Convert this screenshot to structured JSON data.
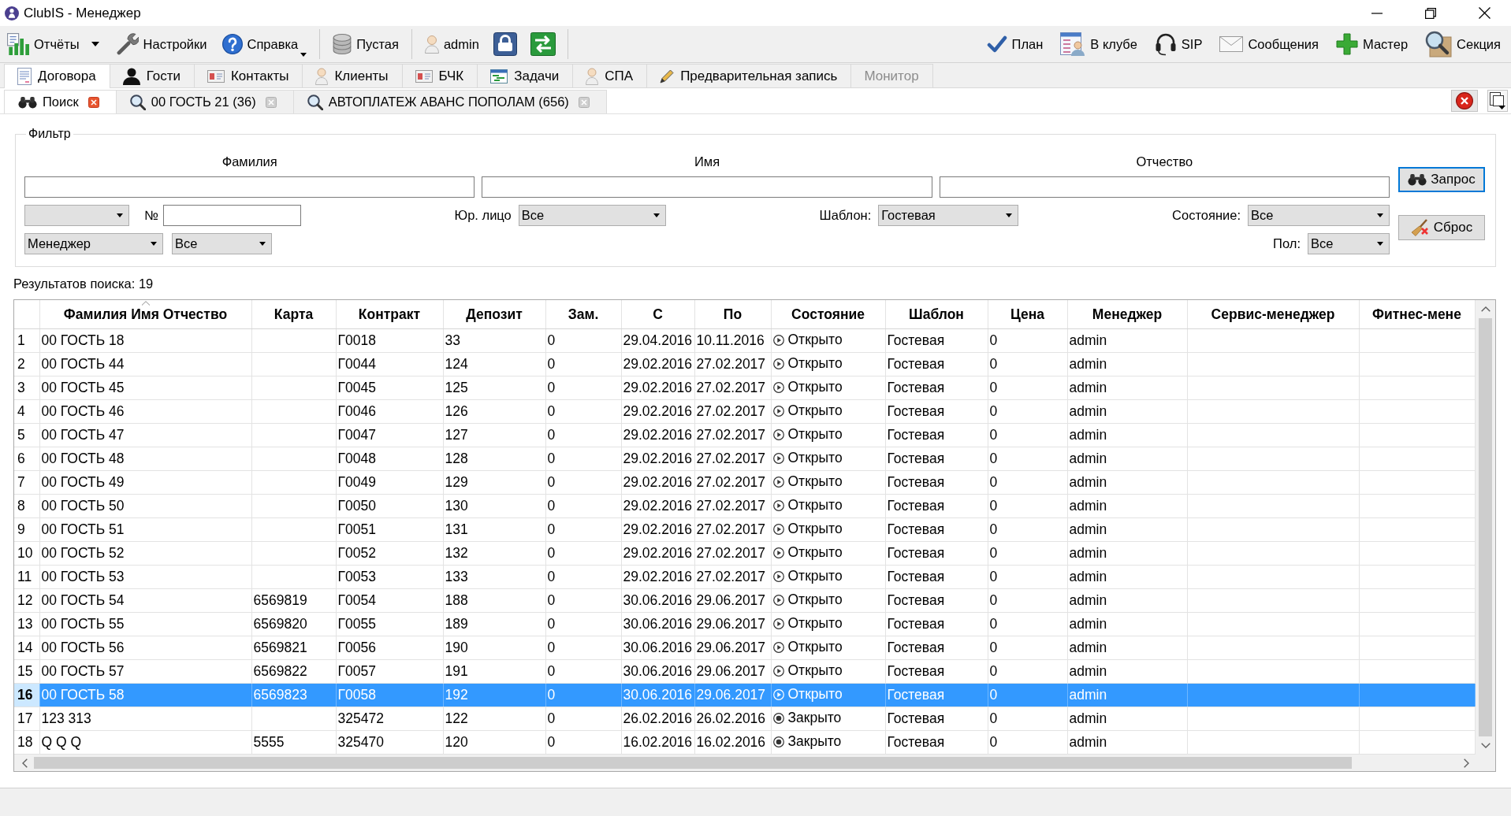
{
  "window": {
    "title": "ClubIS - Менеджер"
  },
  "toolbar": {
    "left_groups": [
      [
        {
          "label": "Отчёты",
          "kind": "split"
        },
        {
          "label": "Настройки",
          "kind": "plain"
        },
        {
          "label": "Справка",
          "kind": "menu"
        }
      ],
      [
        {
          "label": "Пустая",
          "kind": "plain"
        }
      ],
      [
        {
          "label": "admin",
          "kind": "plain"
        }
      ]
    ],
    "right": [
      {
        "label": "План"
      },
      {
        "label": "В клубе"
      },
      {
        "label": "SIP"
      },
      {
        "label": "Сообщения"
      },
      {
        "label": "Мастер"
      },
      {
        "label": "Секция"
      }
    ]
  },
  "module_tabs": [
    {
      "label": "Договора",
      "selected": true,
      "disabled": false
    },
    {
      "label": "Гости",
      "selected": false,
      "disabled": false
    },
    {
      "label": "Контакты",
      "selected": false,
      "disabled": false
    },
    {
      "label": "Клиенты",
      "selected": false,
      "disabled": false
    },
    {
      "label": "БЧК",
      "selected": false,
      "disabled": false
    },
    {
      "label": "Задачи",
      "selected": false,
      "disabled": false
    },
    {
      "label": "СПА",
      "selected": false,
      "disabled": false
    },
    {
      "label": "Предварительная запись",
      "selected": false,
      "disabled": false
    },
    {
      "label": "Монитор",
      "selected": false,
      "disabled": true
    }
  ],
  "document_tabs": [
    {
      "label": "Поиск",
      "kind": "search",
      "selected": true
    },
    {
      "label": "00 ГОСТЬ 21 (36)",
      "kind": "result",
      "selected": false
    },
    {
      "label": "АВТОПЛАТЕЖ АВАНС ПОПОЛАМ (656)",
      "kind": "result",
      "selected": false
    }
  ],
  "filter": {
    "title": "Фильтр",
    "name_fields": [
      {
        "label": "Фамилия"
      },
      {
        "label": "Имя"
      },
      {
        "label": "Отчество"
      }
    ],
    "number_label": "№",
    "legal_entity": {
      "label": "Юр. лицо",
      "value": "Все"
    },
    "template": {
      "label": "Шаблон:",
      "value": "Гостевая"
    },
    "state": {
      "label": "Состояние:",
      "value": "Все"
    },
    "staff_role": {
      "value": "Менеджер"
    },
    "staff": {
      "value": "Все"
    },
    "gender": {
      "label": "Пол:",
      "value": "Все"
    },
    "buttons": [
      {
        "label": "Запрос",
        "default": true
      },
      {
        "label": "Сброс",
        "default": false
      }
    ]
  },
  "results_label": "Результатов поиска: 19",
  "table": {
    "columns": [
      {
        "label": "Фамилия Имя Отчество",
        "sorted": true
      },
      {
        "label": "Карта",
        "sorted": false
      },
      {
        "label": "Контракт",
        "sorted": false
      },
      {
        "label": "Депозит",
        "sorted": false
      },
      {
        "label": "Зам.",
        "sorted": false
      },
      {
        "label": "С",
        "sorted": false
      },
      {
        "label": "По",
        "sorted": false
      },
      {
        "label": "Состояние",
        "sorted": false
      },
      {
        "label": "Шаблон",
        "sorted": false
      },
      {
        "label": "Цена",
        "sorted": false
      },
      {
        "label": "Менеджер",
        "sorted": false
      },
      {
        "label": "Сервис-менеджер",
        "sorted": false
      },
      {
        "label": "Фитнес-мене",
        "sorted": false
      }
    ],
    "rows": [
      {
        "num": "1",
        "name": "00 ГОСТЬ 18",
        "contract": "Г0018",
        "deposit": "33",
        "frozen": "0",
        "start": "29.04.2016",
        "end": "10.11.2016",
        "status": "Открыто",
        "closed": false,
        "template": "Гостевая",
        "price": "0",
        "manager": "admin",
        "selected": false
      },
      {
        "num": "2",
        "name": "00 ГОСТЬ 44",
        "contract": "Г0044",
        "deposit": "124",
        "frozen": "0",
        "start": "29.02.2016",
        "end": "27.02.2017",
        "status": "Открыто",
        "closed": false,
        "template": "Гостевая",
        "price": "0",
        "manager": "admin",
        "selected": false
      },
      {
        "num": "3",
        "name": "00 ГОСТЬ 45",
        "contract": "Г0045",
        "deposit": "125",
        "frozen": "0",
        "start": "29.02.2016",
        "end": "27.02.2017",
        "status": "Открыто",
        "closed": false,
        "template": "Гостевая",
        "price": "0",
        "manager": "admin",
        "selected": false
      },
      {
        "num": "4",
        "name": "00 ГОСТЬ 46",
        "contract": "Г0046",
        "deposit": "126",
        "frozen": "0",
        "start": "29.02.2016",
        "end": "27.02.2017",
        "status": "Открыто",
        "closed": false,
        "template": "Гостевая",
        "price": "0",
        "manager": "admin",
        "selected": false
      },
      {
        "num": "5",
        "name": "00 ГОСТЬ 47",
        "contract": "Г0047",
        "deposit": "127",
        "frozen": "0",
        "start": "29.02.2016",
        "end": "27.02.2017",
        "status": "Открыто",
        "closed": false,
        "template": "Гостевая",
        "price": "0",
        "manager": "admin",
        "selected": false
      },
      {
        "num": "6",
        "name": "00 ГОСТЬ 48",
        "contract": "Г0048",
        "deposit": "128",
        "frozen": "0",
        "start": "29.02.2016",
        "end": "27.02.2017",
        "status": "Открыто",
        "closed": false,
        "template": "Гостевая",
        "price": "0",
        "manager": "admin",
        "selected": false
      },
      {
        "num": "7",
        "name": "00 ГОСТЬ 49",
        "contract": "Г0049",
        "deposit": "129",
        "frozen": "0",
        "start": "29.02.2016",
        "end": "27.02.2017",
        "status": "Открыто",
        "closed": false,
        "template": "Гостевая",
        "price": "0",
        "manager": "admin",
        "selected": false
      },
      {
        "num": "8",
        "name": "00 ГОСТЬ 50",
        "contract": "Г0050",
        "deposit": "130",
        "frozen": "0",
        "start": "29.02.2016",
        "end": "27.02.2017",
        "status": "Открыто",
        "closed": false,
        "template": "Гостевая",
        "price": "0",
        "manager": "admin",
        "selected": false
      },
      {
        "num": "9",
        "name": "00 ГОСТЬ 51",
        "contract": "Г0051",
        "deposit": "131",
        "frozen": "0",
        "start": "29.02.2016",
        "end": "27.02.2017",
        "status": "Открыто",
        "closed": false,
        "template": "Гостевая",
        "price": "0",
        "manager": "admin",
        "selected": false
      },
      {
        "num": "10",
        "name": "00 ГОСТЬ 52",
        "contract": "Г0052",
        "deposit": "132",
        "frozen": "0",
        "start": "29.02.2016",
        "end": "27.02.2017",
        "status": "Открыто",
        "closed": false,
        "template": "Гостевая",
        "price": "0",
        "manager": "admin",
        "selected": false
      },
      {
        "num": "11",
        "name": "00 ГОСТЬ 53",
        "contract": "Г0053",
        "deposit": "133",
        "frozen": "0",
        "start": "29.02.2016",
        "end": "27.02.2017",
        "status": "Открыто",
        "closed": false,
        "template": "Гостевая",
        "price": "0",
        "manager": "admin",
        "selected": false
      },
      {
        "num": "12",
        "name": "00 ГОСТЬ 54",
        "card": "6569819",
        "contract": "Г0054",
        "deposit": "188",
        "frozen": "0",
        "start": "30.06.2016",
        "end": "29.06.2017",
        "status": "Открыто",
        "closed": false,
        "template": "Гостевая",
        "price": "0",
        "manager": "admin",
        "selected": false
      },
      {
        "num": "13",
        "name": "00 ГОСТЬ 55",
        "card": "6569820",
        "contract": "Г0055",
        "deposit": "189",
        "frozen": "0",
        "start": "30.06.2016",
        "end": "29.06.2017",
        "status": "Открыто",
        "closed": false,
        "template": "Гостевая",
        "price": "0",
        "manager": "admin",
        "selected": false
      },
      {
        "num": "14",
        "name": "00 ГОСТЬ 56",
        "card": "6569821",
        "contract": "Г0056",
        "deposit": "190",
        "frozen": "0",
        "start": "30.06.2016",
        "end": "29.06.2017",
        "status": "Открыто",
        "closed": false,
        "template": "Гостевая",
        "price": "0",
        "manager": "admin",
        "selected": false
      },
      {
        "num": "15",
        "name": "00 ГОСТЬ 57",
        "card": "6569822",
        "contract": "Г0057",
        "deposit": "191",
        "frozen": "0",
        "start": "30.06.2016",
        "end": "29.06.2017",
        "status": "Открыто",
        "closed": false,
        "template": "Гостевая",
        "price": "0",
        "manager": "admin",
        "selected": false
      },
      {
        "num": "16",
        "name": "00 ГОСТЬ 58",
        "card": "6569823",
        "contract": "Г0058",
        "deposit": "192",
        "frozen": "0",
        "start": "30.06.2016",
        "end": "29.06.2017",
        "status": "Открыто",
        "closed": false,
        "template": "Гостевая",
        "price": "0",
        "manager": "admin",
        "selected": true
      },
      {
        "num": "17",
        "name": "123 313",
        "contract": "325472",
        "deposit": "122",
        "frozen": "0",
        "start": "26.02.2016",
        "end": "26.02.2016",
        "status": "Закрыто",
        "closed": true,
        "template": "Гостевая",
        "price": "0",
        "manager": "admin",
        "selected": false
      },
      {
        "num": "18",
        "name": "Q Q Q",
        "card": "5555",
        "contract": "325470",
        "deposit": "120",
        "frozen": "0",
        "start": "16.02.2016",
        "end": "16.02.2016",
        "status": "Закрыто",
        "closed": true,
        "template": "Гостевая",
        "price": "0",
        "manager": "admin",
        "selected": false
      }
    ]
  }
}
